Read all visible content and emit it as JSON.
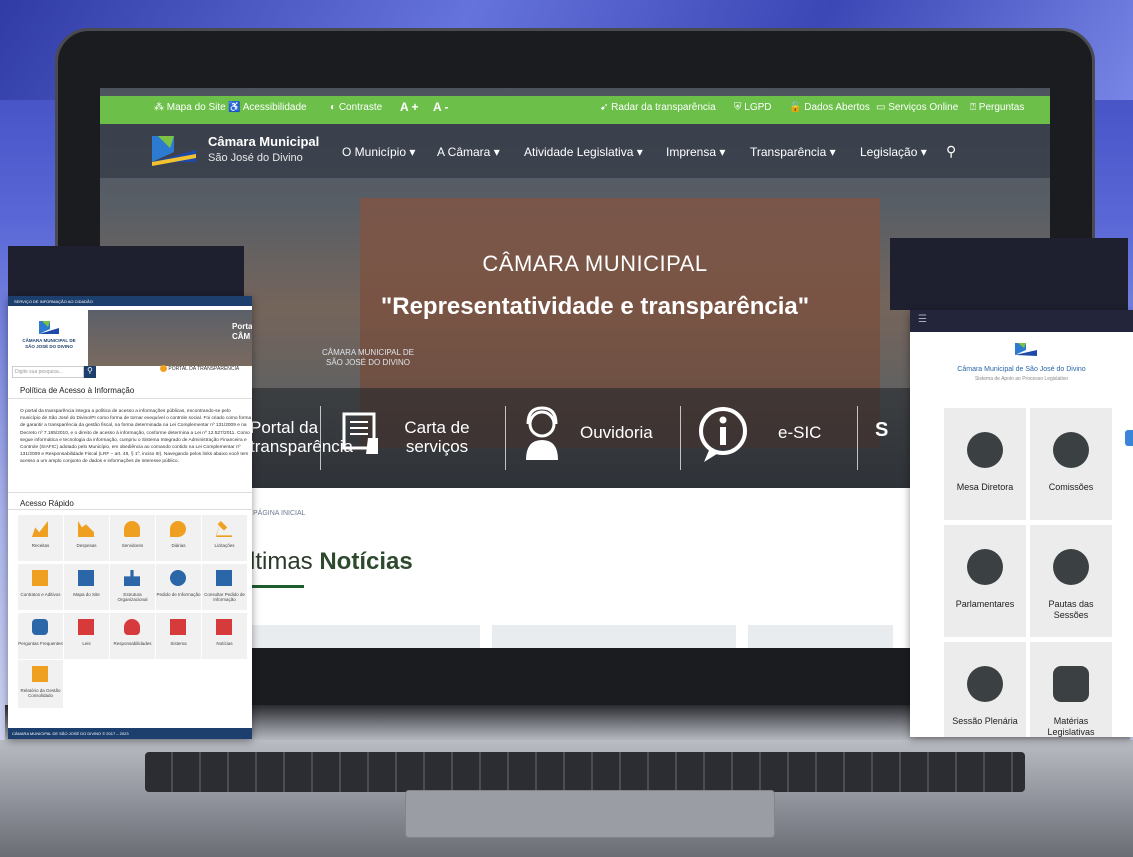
{
  "topbar": {
    "left_items": [
      "Mapa do Site",
      "Acessibilidade",
      "Contraste",
      "A +",
      "A -"
    ],
    "right_items": [
      "Radar da transparência",
      "LGPD",
      "Dados Abertos",
      "Serviços Online",
      "Perguntas"
    ]
  },
  "header": {
    "brand_line1": "Câmara Municipal",
    "brand_line2": "São José do Divino",
    "nav": [
      "O Município ▾",
      "A Câmara ▾",
      "Atividade Legislativa ▾",
      "Imprensa ▾",
      "Transparência ▾",
      "Legislação ▾"
    ],
    "search_icon": "search-icon"
  },
  "hero": {
    "title": "CÂMARA MUNICIPAL",
    "slogan": "\"Representatividade e transparência\"",
    "sign_text": "CÂMARA MUNICIPAL DE SÃO JOSÉ DO DIVINO"
  },
  "quick_links": [
    {
      "label": "Portal da\ntransparência"
    },
    {
      "label": "Carta de\nserviços"
    },
    {
      "label": "Ouvidoria"
    },
    {
      "label": "e-SIC"
    },
    {
      "label": "S"
    }
  ],
  "content": {
    "breadcrumb": "PÁGINA INICIAL",
    "news_prefix": "ltimas ",
    "news_bold": "Notícias"
  },
  "left_panel": {
    "top_strip": "SERVIÇO DE INFORMAÇÃO AO CIDADÃO",
    "hero_text": "Porta\nCÂM",
    "logo_text": "CÂMARA MUNICIPAL DE\nSÃO JOSÉ DO DIVINO",
    "search_placeholder": "Digite sua pesquisa...",
    "portal_link": "PORTAL DA TRANSPARÊNCIA",
    "heading1": "Política de Acesso à Informação",
    "body": "O portal da transparência integra a política de acesso a informações públicas, encontrando-se pelo município de São José do Divino/PI como forma de tornar exequível o controle social. Foi criado como forma de garantir a transparência da gestão fiscal, na forma determinada na Lei Complementar nº 131/2009 e na Decreto nº 7.185/2010, e o direito de acesso à informação, conforme determina a Lei nº 12.527/2011. Como segue informática e tecnologia da informação, cumpriu o Sistema Integrado de Administração Financeira e Controle (SIAFIC) adotado pelo Município, em obediência ao comando contido na Lei Complementar nº 131/2009 e Responsabilidade Fiscal (LRF – art. 48, § 1º, inciso III). Navegando pelos links abaixo você tem acesso a um amplo conjunto de dados e informações de interesse público.",
    "heading2": "Acesso Rápido",
    "tiles": [
      "Receitas",
      "Despesas",
      "Servidores",
      "Diárias",
      "Licitações",
      "Contratos e Aditivos",
      "Mapa do Site",
      "Estrutura Organizacional",
      "Pedido de Informação",
      "Consultar Pedido de Informação",
      "Perguntas Frequentes",
      "Leis",
      "Responsabilidades",
      "Sistema",
      "Notícias",
      "Relatório da Gestão Consolidado"
    ],
    "footer": "CÂMARA MUNICIPAL DE SÃO JOSÉ DO DIVINO © 2017 – 2023"
  },
  "right_panel": {
    "title": "Câmara Municipal de São José do Divino",
    "subtitle": "Sistema de Apoio ao Processo Legislativo",
    "cards": [
      "Mesa Diretora",
      "Comissões",
      "Parlamentares",
      "Pautas das Sessões",
      "Sessão Plenária",
      "Matérias Legislativas"
    ]
  },
  "colors": {
    "green": "#6cc04a",
    "navy": "#1d3f6e",
    "dark_green": "#1e5b2d"
  }
}
